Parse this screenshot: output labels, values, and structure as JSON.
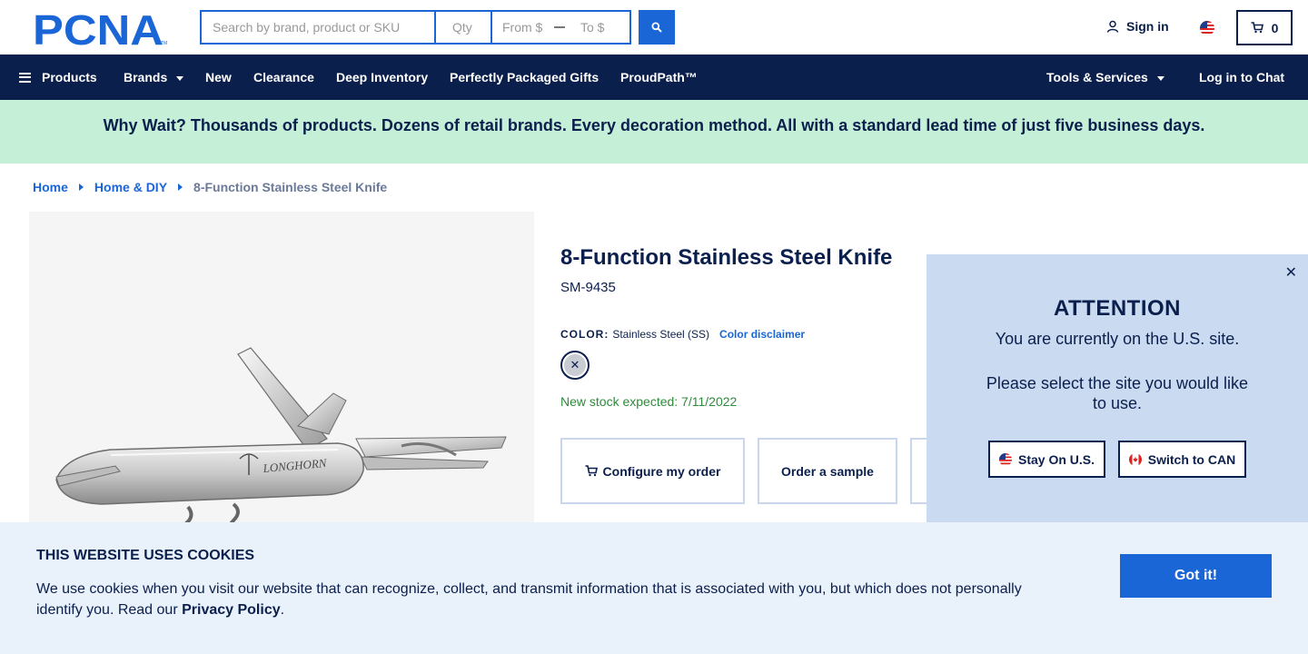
{
  "header": {
    "logo_text": "PCNA",
    "search_placeholder": "Search by brand, product or SKU",
    "qty_placeholder": "Qty",
    "price_from_placeholder": "From $",
    "price_to_placeholder": "To $",
    "search_icon": "search-icon",
    "signin_label": "Sign in",
    "cart_count": "0"
  },
  "nav": {
    "products_label": "Products",
    "items": [
      {
        "label": "Brands"
      },
      {
        "label": "New"
      },
      {
        "label": "Clearance"
      },
      {
        "label": "Deep Inventory"
      },
      {
        "label": "Perfectly Packaged Gifts"
      },
      {
        "label": "ProudPath™"
      }
    ],
    "tools_label": "Tools & Services",
    "chat_label": "Log in to Chat"
  },
  "promo": {
    "text": "Why Wait? Thousands of products. Dozens of retail brands. Every decoration method. All with a standard lead time of just five business days."
  },
  "breadcrumb": {
    "items": [
      "Home",
      "Home & DIY"
    ],
    "current": "8-Function Stainless Steel Knife"
  },
  "product": {
    "title": "8-Function Stainless Steel Knife",
    "sku": "SM-9435",
    "color_label": "COLOR:",
    "color_value": "Stainless Steel (SS)",
    "color_disclaimer": "Color disclaimer",
    "swatch_symbol": "✕",
    "stock": "New stock expected: 7/11/2022",
    "actions": [
      {
        "label": "Configure my order"
      },
      {
        "label": "Order a sample"
      }
    ],
    "image_brand": "LONGHORN"
  },
  "modal": {
    "close_symbol": "✕",
    "title": "ATTENTION",
    "line1": "You are currently on the U.S. site.",
    "line2": "Please select the site you would like to use.",
    "stay_label": "Stay On U.S.",
    "switch_label": "Switch to CAN"
  },
  "cookies": {
    "title": "THIS WEBSITE USES COOKIES",
    "text": "We use cookies when you visit our website that can recognize, collect, and transmit information that is associated with you, but which does not personally identify you. Read our ",
    "link": "Privacy Policy",
    "end": ".",
    "button": "Got it!"
  },
  "colors": {
    "navy": "#0b1f4d",
    "blue": "#1a66d6",
    "promo_bg": "#c5efd7",
    "modal_bg": "#c9daf1",
    "cookie_bg": "#e9f1fb",
    "stock_green": "#2e8b3a"
  }
}
